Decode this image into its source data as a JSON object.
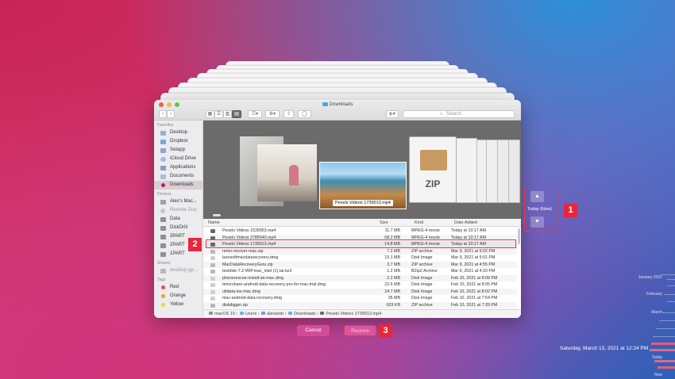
{
  "window": {
    "title": "Downloads"
  },
  "toolbar": {
    "search_placeholder": "Search",
    "back_label": "‹",
    "forward_label": "›",
    "view_icons": "▦",
    "view_list": "☰",
    "view_columns": "▥",
    "view_gallery": "▤",
    "group_label": "☷▾",
    "action_label": "⚙▾",
    "share_label": "⇪",
    "tag_label": "◯",
    "dropbox_label": "⬖▾"
  },
  "sidebar": {
    "sections": [
      {
        "header": "Favorites",
        "items": [
          {
            "label": "Desktop",
            "icon": "desktop-icon"
          },
          {
            "label": "Dropbox",
            "icon": "dropbox-icon"
          },
          {
            "label": "Setapp",
            "icon": "setapp-icon"
          },
          {
            "label": "iCloud Drive",
            "icon": "cloud-icon"
          },
          {
            "label": "Applications",
            "icon": "applications-icon"
          },
          {
            "label": "Documents",
            "icon": "documents-icon"
          },
          {
            "label": "Downloads",
            "icon": "downloads-icon"
          }
        ]
      },
      {
        "header": "Devices",
        "items": [
          {
            "label": "Alex's Mac...",
            "icon": "laptop-icon"
          },
          {
            "label": "Remote Disc",
            "icon": "disc-icon"
          },
          {
            "label": "Data",
            "icon": "drive-icon"
          },
          {
            "label": "DiskDrill",
            "icon": "drive-icon"
          },
          {
            "label": "3PART",
            "icon": "drive-icon"
          },
          {
            "label": "2PART",
            "icon": "drive-icon"
          },
          {
            "label": "1PART",
            "icon": "drive-icon"
          }
        ]
      },
      {
        "header": "Shared",
        "items": [
          {
            "label": "desktop-gp...",
            "icon": "network-icon"
          }
        ]
      },
      {
        "header": "Tags",
        "items": [
          {
            "label": "Red",
            "icon": "tag-red-icon"
          },
          {
            "label": "Orange",
            "icon": "tag-orange-icon"
          },
          {
            "label": "Yellow",
            "icon": "tag-yellow-icon"
          }
        ]
      }
    ]
  },
  "gallery": {
    "caption": "Pexels Videos 1739013.mp4",
    "zip_label": "ZIP"
  },
  "list": {
    "columns": {
      "name": "Name",
      "size": "Size",
      "kind": "Kind",
      "date": "Date Added"
    },
    "rows": [
      {
        "name": "Pexels Videos 1539953.mp4",
        "size": "11.7 MB",
        "kind": "MPEG-4 movie",
        "date": "Today at 10:17 AM"
      },
      {
        "name": "Pexels Videos 2786540.mp4",
        "size": "68.2 MB",
        "kind": "MPEG-4 movie",
        "date": "Today at 10:17 AM"
      },
      {
        "name": "Pexels Videos 1739013.mp4",
        "size": "14.8 MB",
        "kind": "MPEG-4 movie",
        "date": "Today at 10:17 AM"
      },
      {
        "name": "remo-recover-mac.zip",
        "size": "7.2 MB",
        "kind": "ZIP archive",
        "date": "Mar 9, 2021 at 5:02 PM"
      },
      {
        "name": "lazesoftmacdatarecovery.dmg",
        "size": "15.1 MB",
        "kind": "Disk Image",
        "date": "Mar 9, 2021 at 5:01 PM"
      },
      {
        "name": "MacDataRecoveryGuru.zip",
        "size": "3.7 MB",
        "kind": "ZIP archive",
        "date": "Mar 9, 2021 at 4:55 PM"
      },
      {
        "name": "testdisk-7.2-WIP.mac_intel (1).tar.bz2",
        "size": "1.2 MB",
        "kind": "BZip2 Archive",
        "date": "Mar 9, 2021 at 4:33 PM"
      },
      {
        "name": "phonerescue-install-an-mac.dmg",
        "size": "2.2 MB",
        "kind": "Disk Image",
        "date": "Feb 10, 2021 at 8:09 PM"
      },
      {
        "name": "tenorshare-android-data-recovery-pro-for-mac-trial.dmg",
        "size": "22.6 MB",
        "kind": "Disk Image",
        "date": "Feb 10, 2021 at 8:05 PM"
      },
      {
        "name": "ultdata-ios-mac.dmg",
        "size": "24.7 MB",
        "kind": "Disk Image",
        "date": "Feb 10, 2021 at 8:02 PM"
      },
      {
        "name": "mac-android-data-recovery.dmg",
        "size": "35 MB",
        "kind": "Disk Image",
        "date": "Feb 10, 2021 at 7:54 PM"
      },
      {
        "name": "diskdigger.zip",
        "size": "629 KB",
        "kind": "ZIP archive",
        "date": "Feb 10, 2021 at 7:39 PM"
      }
    ]
  },
  "pathbar": {
    "segments": [
      "macOS 10",
      "Users",
      "alexandr",
      "Downloads",
      "Pexels Videos 1739013.mp4"
    ]
  },
  "timemachine": {
    "up_arrow": "▲",
    "down_arrow": "▼",
    "now_label": "Today (Now)",
    "cancel_label": "Cancel",
    "restore_label": "Restore",
    "datetime": "Saturday, March 13, 2021 at 12:24 PM",
    "timeline_labels": [
      "January 2021",
      "February",
      "March",
      "Today",
      "Now"
    ]
  },
  "markers": [
    "1",
    "2",
    "3"
  ],
  "colors": {
    "accent_red": "#e8263a",
    "button_pink": "#d44a9a",
    "selection_fill": "#e8e8ec"
  }
}
